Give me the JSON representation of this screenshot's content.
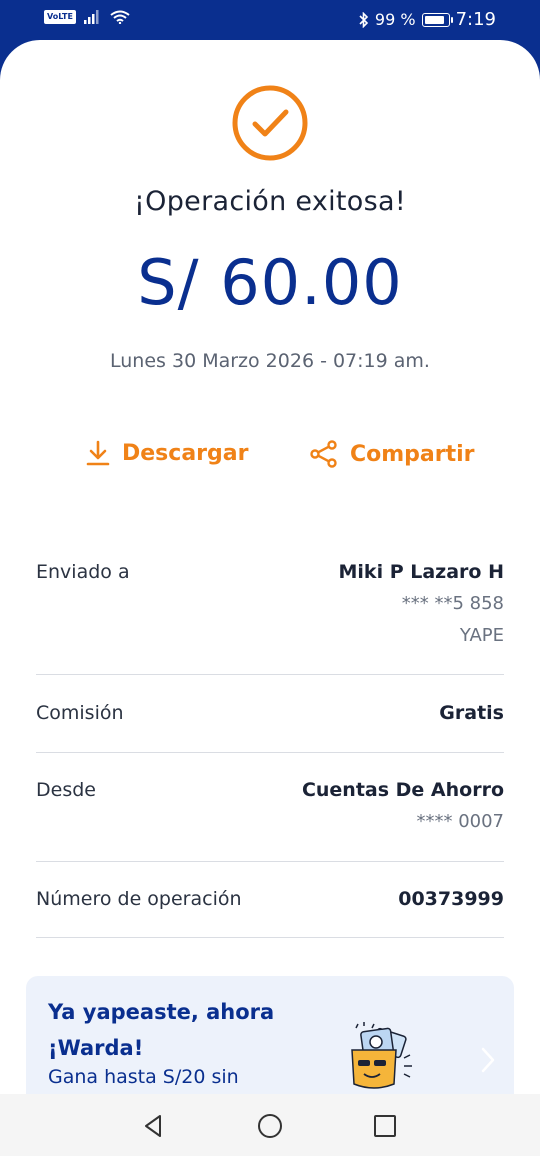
{
  "status_bar": {
    "volte": "VoLTE",
    "battery": "99 %",
    "time": "7:19"
  },
  "receipt": {
    "title": "¡Operación exitosa!",
    "amount": "S/ 60.00",
    "datetime": "Lunes 30 Marzo 2026 - 07:19 am.",
    "download_label": "Descargar",
    "share_label": "Compartir",
    "details": {
      "sent_to": {
        "label": "Enviado a",
        "name": "Miki P Lazaro H",
        "phone": "*** **5 858",
        "app": "YAPE"
      },
      "commission": {
        "label": "Comisión",
        "value": "Gratis"
      },
      "from": {
        "label": "Desde",
        "account": "Cuentas De Ahorro",
        "number": "**** 0007"
      },
      "operation": {
        "label": "Número de operación",
        "value": "00373999"
      }
    }
  },
  "promo": {
    "title": "Ya yapeaste, ahora ¡Warda!",
    "subtitle": "Gana hasta S/20 sin"
  },
  "colors": {
    "brand_blue": "#0a2f8f",
    "accent_orange": "#f08217"
  }
}
